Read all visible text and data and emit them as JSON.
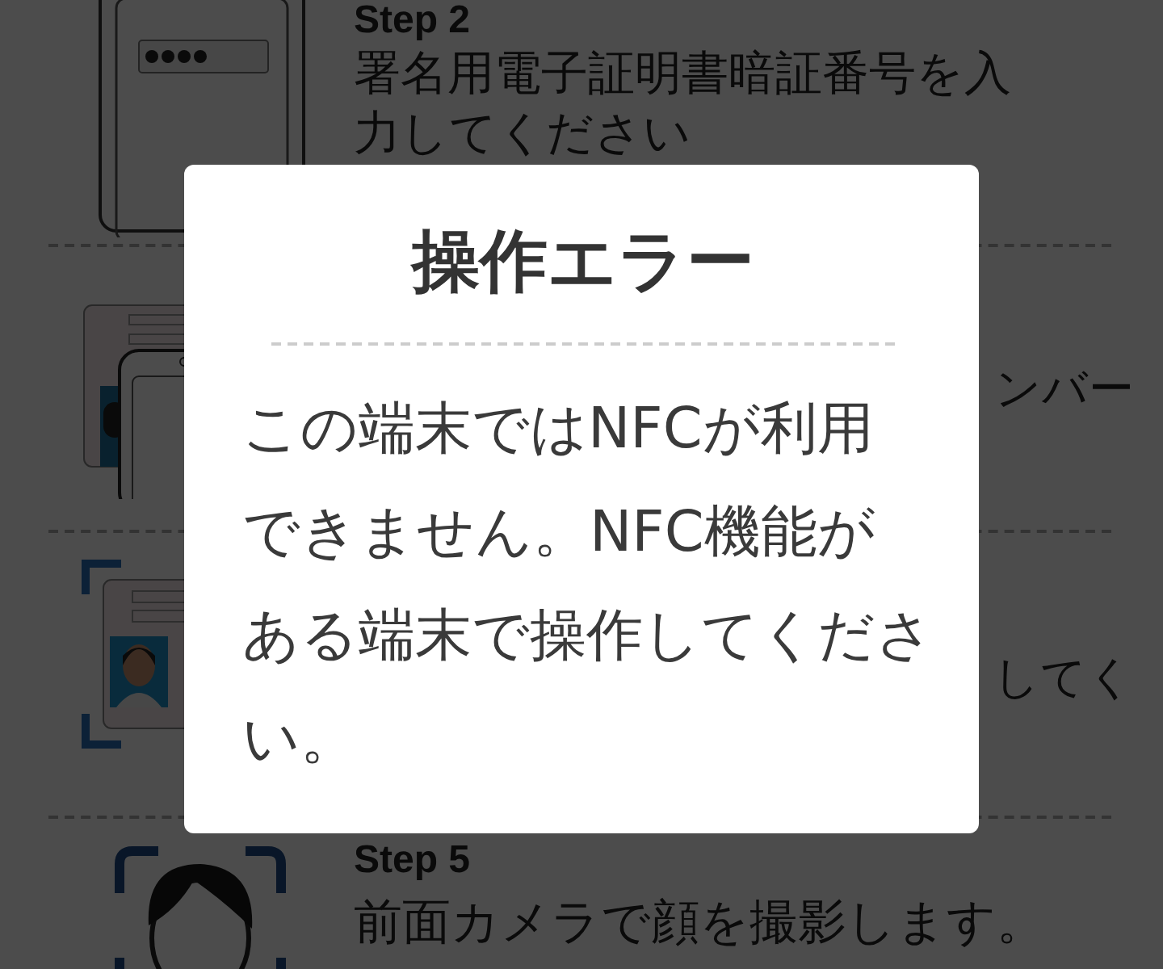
{
  "steps": [
    {
      "kind": "phone_pin",
      "label": "Step 2",
      "description_lines": [
        "署名用電子証明書暗証番号を入",
        "力してください"
      ]
    },
    {
      "kind": "card_phone",
      "description_lines": [
        "ンバー"
      ],
      "cut": true
    },
    {
      "kind": "card_scan",
      "description_lines": [
        "してく"
      ],
      "cut": true
    },
    {
      "kind": "face_scan",
      "label": "Step 5",
      "description_lines": [
        "前面カメラで顔を撮影します。"
      ]
    }
  ],
  "dialog": {
    "title": "操作エラー",
    "message_lines": [
      "この端末ではNFCが利用",
      "できません。NFC機能が",
      "ある端末で操作してくださ",
      "い。"
    ]
  }
}
